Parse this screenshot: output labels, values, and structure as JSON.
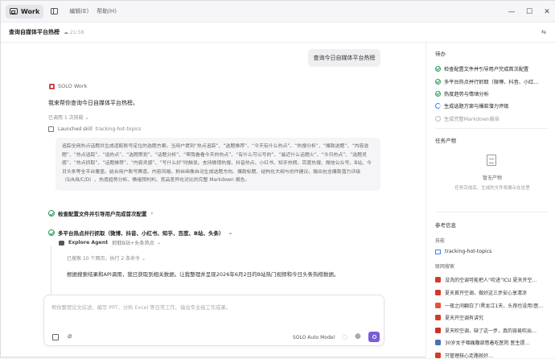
{
  "titlebar": {
    "app_name": "Work",
    "menus": [
      "编辑(E)",
      "帮助(H)"
    ],
    "window_controls": [
      "—",
      "☐",
      "✕"
    ]
  },
  "header": {
    "title": "查询自媒体平台热榜",
    "time": "21:58"
  },
  "chat": {
    "user_message": "查询今日自媒体平台热榜",
    "agent_name": "SOLO Work",
    "agent_intro": "我来帮你查询今日自媒体平台热榜。",
    "tools_used": "已调用 1 次技能",
    "skill_launched_label": "Launched skill",
    "skill_launched_name": "tracking-hot-topics",
    "skill_description": "追踪全网热点话题并生成适配账号定位的选题方案。当用户提到“热点追踪”、“选题推荐”、“今天有什么热点”、“热搜分析”、“爆款选题”、“内容选题”、“热点追踪”、“追热点”、“选题策划”、“话题分析”、“帮我看看今天的热点”、“有什么可以写的”、“最近什么话题火”、“今日热点”、“选题灵感”、“热点抓取”、“话题推荐”、“内容灵感”、“写什么好”时触发。支持微博热搜、抖音热点、小红书、知乎热榜、百度热搜、微信公众号、B站、今日头条等全平台覆盖。结合用户账号赛道、内容风格、粉丝画像自动生成选题方向、爆款标题、结构化大纲与创作建议。输出包含爆款潜力评级（S/A/B/C/D）、热度趋势分析、情绪预判判、竞品差异化对比的完整 Markdown 报告。",
    "task1": "检查配置文件并引导用户完成首次配置",
    "task2": "多平台热点并行抓取（微博、抖音、小红书、知乎、百度、B站、头条）",
    "explore_agent": "Explore Agent",
    "explore_task": "抓取B站+头条热点",
    "searched": "已搜索 10 个网页，执行 2 条命令",
    "result_text": "根据搜索结果和API调用，我已获取到相关数据。让我整理并呈现2026年6月2日的B站热门视频和今日头条热榜数据。",
    "input_placeholder": "帮你整理论文综述、编写 PPT、分析 Excel 等日常工作、输出专业级工作成果。",
    "model": "SOLO Auto Model"
  },
  "right_panel": {
    "todo_title": "待办",
    "todos": [
      {
        "label": "检查配置文件并引导用户完成首次配置",
        "status": "done"
      },
      {
        "label": "多平台热点并行抓取（微博、抖音、小红…",
        "status": "done"
      },
      {
        "label": "热度趋势与情绪分析",
        "status": "done"
      },
      {
        "label": "生成选题方案与爆款潜力评级",
        "status": "in_progress"
      },
      {
        "label": "生成完整Markdown报告",
        "status": "pending"
      }
    ],
    "products_title": "任务产物",
    "products_empty": "暂无产物",
    "products_hint": "任务完成后，生成的文件将展示在这里",
    "ref_title": "参考信息",
    "skills_label": "技能",
    "skill_item": "tracking-hot-topics",
    "web_search_label": "联网搜索",
    "news": [
      {
        "text": "没洗的空调可能把人“吹进”ICU 夏天开空…",
        "color": "#d33a2c"
      },
      {
        "text": "夏天首开空调，做好这三步安心享清凉",
        "color": "#d33a2c"
      },
      {
        "text": "一夜之间翻白了!黑龙江1天，头孢也没用!医…",
        "color": "#e8503a"
      },
      {
        "text": "夏天开空调有讲究",
        "color": "#d33a2c"
      },
      {
        "text": "夏天吹空调，缺了这一步，真的容易吹出…",
        "color": "#cf2f25"
      },
      {
        "text": "30岁女子咽痛腹部憋着吃医院 医生提…",
        "color": "#4a6fb5"
      },
      {
        "text": "只管理核心走路就好…",
        "color": "#d33a2c"
      }
    ]
  }
}
